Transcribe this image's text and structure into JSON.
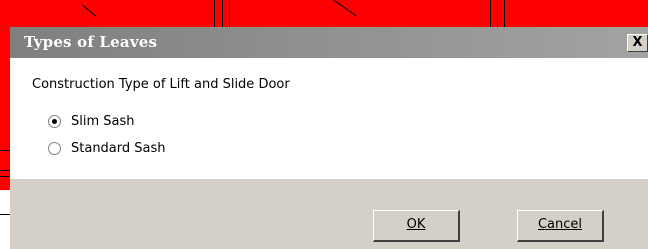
{
  "dialog": {
    "title": "Types of Leaves",
    "close_label": "X",
    "prompt": "Construction Type of Lift and Slide Door",
    "options": [
      {
        "label": "Slim Sash",
        "selected": true
      },
      {
        "label": "Standard Sash",
        "selected": false
      }
    ],
    "buttons": {
      "ok_label": "OK",
      "cancel_label": "Cancel"
    }
  },
  "colors": {
    "background_red": "#ff0000",
    "dialog_face": "#d4d0c8",
    "titlebar_start": "#7f7f7f",
    "titlebar_end": "#a3a3a3"
  }
}
